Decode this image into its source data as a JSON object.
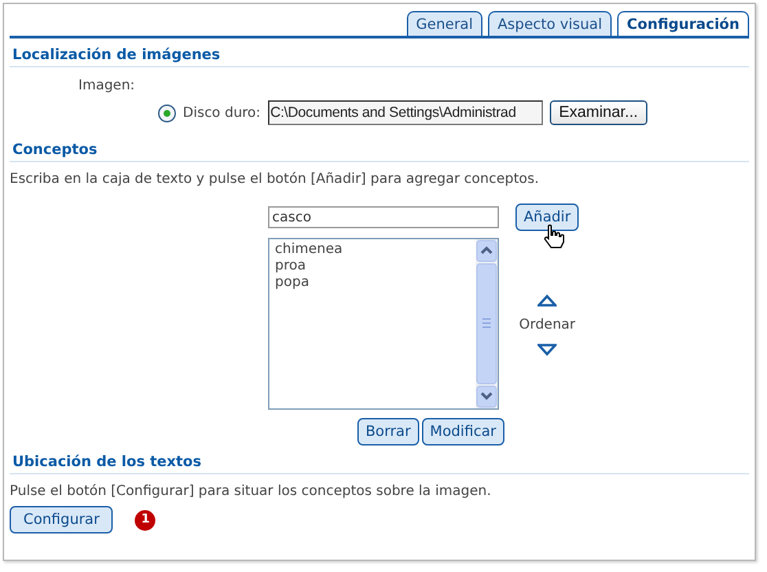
{
  "tabs": [
    {
      "label": "General",
      "selected": false
    },
    {
      "label": "Aspecto visual",
      "selected": false
    },
    {
      "label": "Configuración",
      "selected": true
    }
  ],
  "image_location": {
    "title": "Localización de imágenes",
    "image_label": "Imagen:",
    "source": {
      "label": "Disco duro:",
      "selected": true
    },
    "path": "C:\\Documents and Settings\\Administrad",
    "browse_button": "Examinar..."
  },
  "concepts": {
    "title": "Conceptos",
    "instructions": "Escriba en la caja de texto y pulse el botón [Añadir] para agregar conceptos.",
    "input": "casco",
    "add_button": "Añadir",
    "items": [
      "chimenea",
      "proa",
      "popa"
    ],
    "order_label": "Ordenar",
    "delete_button": "Borrar",
    "modify_button": "Modificar"
  },
  "text_placement": {
    "title": "Ubicación de los textos",
    "instructions": "Pulse el botón [Configurar] para situar los conceptos sobre la imagen.",
    "configure_button": "Configurar",
    "badge": "1"
  }
}
